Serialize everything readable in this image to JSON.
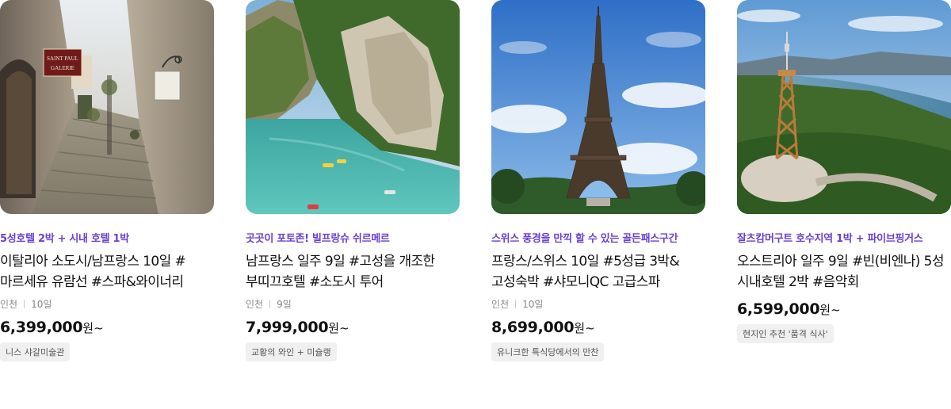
{
  "cards": [
    {
      "image_icon": "stone-alley-photo",
      "sign_text": "SAINT PAUL\nGALERIE",
      "promo": "5성호텔 2박 + 시내 호텔 1박",
      "title": "이탈리아 소도시/남프랑스 10일 #마르세유 유람선 #스파&와이너리",
      "departure": "인천",
      "duration": "10일",
      "price": "6,399,000",
      "currency": "원",
      "suffix": "~",
      "tag": "니스 샤갈미술관"
    },
    {
      "image_icon": "verdon-gorge-photo",
      "promo": "곳곳이 포토존! 빌프랑슈 쉬르메르",
      "title": "남프랑스 일주 9일 #고성을 개조한 부띠끄호텔 #소도시 투어",
      "departure": "인천",
      "duration": "9일",
      "price": "7,999,000",
      "currency": "원",
      "suffix": "~",
      "tag": "교황의 와인 + 미슐랭"
    },
    {
      "image_icon": "eiffel-tower-photo",
      "promo": "스위스 풍경을 만끽 할 수 있는 골든패스구간",
      "title": "프랑스/스위스 10일 #5성급 3박&고성숙박 #샤모니QC 고급스파",
      "departure": "인천",
      "duration": "10일",
      "price": "8,699,000",
      "currency": "원",
      "suffix": "~",
      "tag": "유니크한 특식당에서의 만찬"
    },
    {
      "image_icon": "pyramidenkogel-tower-photo",
      "promo": "잘츠캄머구트 호수지역 1박 + 파이브핑거스",
      "title": "오스트리아 일주 9일 #빈(비엔나) 5성 시내호텔 2박 #음악회",
      "departure": "",
      "duration": "",
      "price": "6,599,000",
      "currency": "원",
      "suffix": "~",
      "tag": "현지인 추천 '품격 식사'"
    }
  ]
}
